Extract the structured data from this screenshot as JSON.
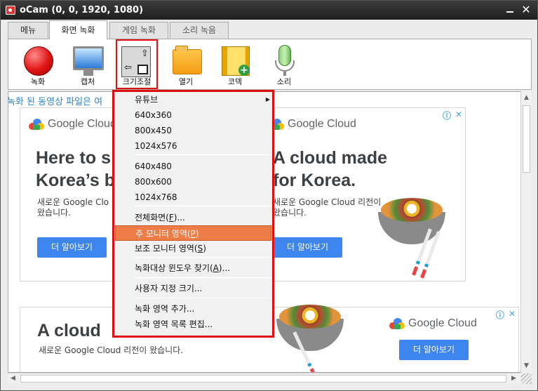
{
  "window": {
    "title": "oCam (0, 0, 1920, 1080)"
  },
  "tabs": [
    {
      "label": "메뉴",
      "active": false
    },
    {
      "label": "화면 녹화",
      "active": true
    },
    {
      "label": "게임 녹화",
      "active": false
    },
    {
      "label": "소리 녹음",
      "active": false
    }
  ],
  "toolbar": {
    "record": "녹화",
    "capture": "캡처",
    "resize": "크기조절",
    "open": "열기",
    "codec": "코덱",
    "sound": "소리"
  },
  "content": {
    "notice": "녹화 된 동영상 파일은 여"
  },
  "ad1": {
    "logo": "Google Cloud",
    "headline_left_1": "Here to s",
    "headline_left_2": "Korea’s b",
    "sub_left_1": "새로운 Google Clo",
    "sub_left_2": "왔습니다.",
    "button_left": "더 알아보기",
    "logo_right": "Google Cloud",
    "headline_right_1": "A cloud made",
    "headline_right_2": "for Korea.",
    "sub_right_1": "새로운 Google Cloud 리전이",
    "sub_right_2": "왔습니다.",
    "button_right": "더 알아보기"
  },
  "ad2": {
    "headline": "A cloud",
    "sub": "새로운 Google Cloud 리전이 왔습니다.",
    "logo": "Google Cloud",
    "button": "더 알아보기"
  },
  "menu": {
    "youtube": "유튜브",
    "r640x360": "640x360",
    "r800x450": "800x450",
    "r1024x576": "1024x576",
    "r640x480": "640x480",
    "r800x600": "800x600",
    "r1024x768": "1024x768",
    "fullscreen_pre": "전체화면(",
    "fullscreen_key": "F",
    "fullscreen_post": ")...",
    "primary_pre": "주 모니터 영역(",
    "primary_key": "P",
    "primary_post": ")",
    "secondary_pre": "보조 모니터 영역(",
    "secondary_key": "S",
    "secondary_post": ")",
    "findwin_pre": "녹화대상 윈도우 찾기(",
    "findwin_key": "A",
    "findwin_post": ")...",
    "custom": "사용자 지정 크기...",
    "add_area": "녹화 영역 추가...",
    "edit_list": "녹화 영역 목록 편집..."
  },
  "colors": {
    "highlight": "#ee7c47",
    "annotation": "#e01010",
    "google_blue": "#3d86f0"
  }
}
